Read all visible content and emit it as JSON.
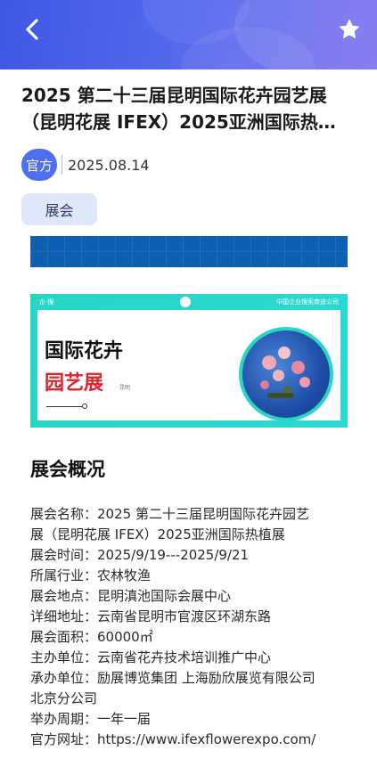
{
  "header": {
    "back_icon": "chevron-left-icon",
    "favorite_icon": "star-icon",
    "gradient_start": "#3f57e6",
    "gradient_end": "#7a6ff0"
  },
  "article": {
    "title_line1": "2025 第二十三届昆明国际花卉园艺展",
    "title_line2": "（昆明花展 IFEX）2025亚洲国际热…",
    "source_label": "官方",
    "date": "2025.08.14",
    "tag": "展会"
  },
  "banner": {
    "top_left": "企·搜",
    "top_right": "中国企业搜索商道公司",
    "line1": "国际花卉",
    "line2": "园艺展",
    "sub": "· 昆明",
    "accent_color": "#28d6c4",
    "red_color": "#e0232a"
  },
  "overview": {
    "section_title": "展会概况",
    "rows": [
      "展会名称：2025 第二十三届昆明国际花卉园艺",
      "展（昆明花展 IFEX）2025亚洲国际热植展",
      "展会时间：2025/9/19---2025/9/21",
      "所属行业：农林牧渔",
      "展会地点：昆明滇池国际会展中心",
      "详细地址：云南省昆明市官渡区环湖东路",
      "展会面积：60000㎡",
      "主办单位：云南省花卉技术培训推广中心",
      "承办单位：励展博览集团 上海励欣展览有限公司",
      "北京分公司",
      "举办周期：一年一届",
      "官方网址：https://www.ifexflowerexpo.com/"
    ]
  }
}
